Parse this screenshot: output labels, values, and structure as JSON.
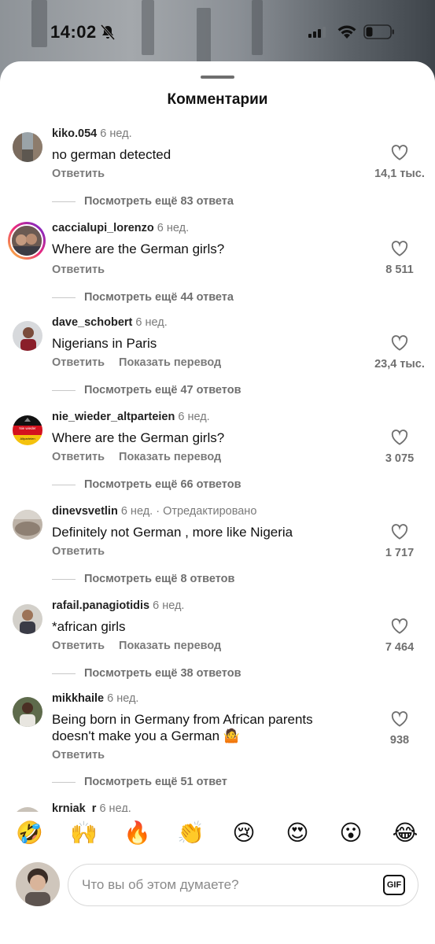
{
  "status_bar": {
    "time": "14:02"
  },
  "sheet": {
    "title": "Комментарии"
  },
  "comments": [
    {
      "user": "kiko.054",
      "age": "6 нед.",
      "edited": "",
      "text": "no german detected",
      "reply": "Ответить",
      "translate": "",
      "more_replies": "Посмотреть ещё 83 ответа",
      "likes": "14,1 тыс."
    },
    {
      "user": "caccialupi_lorenzo",
      "age": "6 нед.",
      "edited": "",
      "text": "Where are the German girls?",
      "reply": "Ответить",
      "translate": "",
      "more_replies": "Посмотреть ещё 44 ответа",
      "likes": "8 511"
    },
    {
      "user": "dave_schobert",
      "age": "6 нед.",
      "edited": "",
      "text": "Nigerians in Paris",
      "reply": "Ответить",
      "translate": "Показать перевод",
      "more_replies": "Посмотреть ещё 47 ответов",
      "likes": "23,4 тыс."
    },
    {
      "user": "nie_wieder_altparteien",
      "age": "6 нед.",
      "edited": "",
      "text": "Where are the German girls?",
      "reply": "Ответить",
      "translate": "Показать перевод",
      "more_replies": "Посмотреть ещё 66 ответов",
      "likes": "3 075"
    },
    {
      "user": "dinevsvetlin",
      "age": "6 нед.",
      "edited": "· Отредактировано",
      "text": "Definitely not German , more like Nigeria",
      "reply": "Ответить",
      "translate": "",
      "more_replies": "Посмотреть ещё 8 ответов",
      "likes": "1 717"
    },
    {
      "user": "rafail.panagiotidis",
      "age": "6 нед.",
      "edited": "",
      "text": "*african girls",
      "reply": "Ответить",
      "translate": "Показать перевод",
      "more_replies": "Посмотреть ещё 38 ответов",
      "likes": "7 464"
    },
    {
      "user": "mikkhaile",
      "age": "6 нед.",
      "edited": "",
      "text": "Being born in Germany from African parents doesn't make you a German 🤷",
      "reply": "Ответить",
      "translate": "",
      "more_replies": "Посмотреть ещё 51 ответ",
      "likes": "938"
    },
    {
      "user": "krniak_r",
      "age": "6 нед.",
      "edited": "",
      "text": "",
      "reply": "",
      "translate": "",
      "more_replies": "",
      "likes": ""
    }
  ],
  "avatar_labels": {
    "nie_wieder": [
      "Nie wieder",
      "Altparteien"
    ]
  },
  "reactions": [
    "🤣",
    "🙌",
    "🔥",
    "👏",
    "😢",
    "😍",
    "😮",
    "😂"
  ],
  "composer": {
    "placeholder": "Что вы об этом думаете?",
    "gif_label": "GIF"
  }
}
